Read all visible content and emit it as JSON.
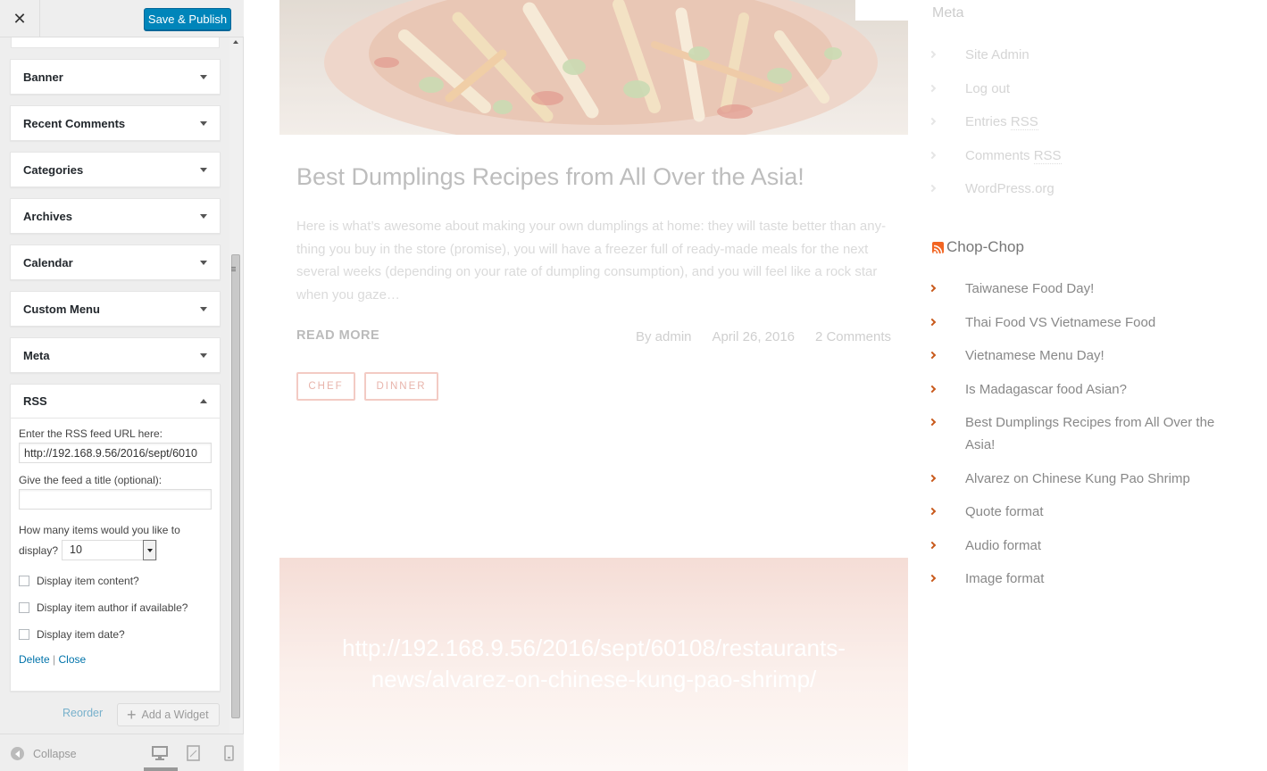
{
  "topbar": {
    "close_glyph": "✕",
    "publish_label": "Save & Publish"
  },
  "widgets": [
    {
      "title": "Banner"
    },
    {
      "title": "Recent Comments"
    },
    {
      "title": "Categories"
    },
    {
      "title": "Archives"
    },
    {
      "title": "Calendar"
    },
    {
      "title": "Custom Menu"
    },
    {
      "title": "Meta"
    }
  ],
  "rss_widget": {
    "title": "RSS",
    "url_label": "Enter the RSS feed URL here:",
    "url_value": "http://192.168.9.56/2016/sept/6010",
    "title_label": "Give the feed a title (optional):",
    "title_value": "",
    "count_label_1": "How many items would you like to",
    "count_label_2": "display?",
    "count_value": "10",
    "options": [
      {
        "label": "Display item content?",
        "checked": false
      },
      {
        "label": "Display item author if available?",
        "checked": false
      },
      {
        "label": "Display item date?",
        "checked": false
      }
    ],
    "delete_label": "Delete",
    "separator": "|",
    "close_label": "Close"
  },
  "panel_actions": {
    "reorder_label": "Reorder",
    "add_widget_label": "Add a Widget"
  },
  "footer": {
    "collapse_label": "Collapse",
    "devices": [
      "desktop-icon",
      "tablet-icon",
      "mobile-icon"
    ]
  },
  "post": {
    "title": "Best Dumplings Recipes from All Over the Asia!",
    "excerpt": "Here is what’s awesome about making your own dumplings at home: they will taste better than any-thing you buy in the store (promise), you will have a freezer full of ready-made meals for the next several weeks (depending on your rate of dumpling consumption), and you will feel like a rock star when you gaze…",
    "read_more": "READ MORE",
    "author": "By admin",
    "date": "April 26, 2016",
    "comments": "2 Comments",
    "tags": [
      "CHEF",
      "DINNER"
    ]
  },
  "quote_post": {
    "text": "http://192.168.9.56/2016/sept/60108/restaurants-news/alvarez-on-chinese-kung-pao-shrimp/"
  },
  "sidebar_meta": {
    "heading": "Meta",
    "items": [
      "Site Admin",
      "Log out",
      "Entries",
      "Comments",
      "WordPress.org"
    ],
    "rss_abbr": "RSS"
  },
  "sidebar_rss": {
    "heading": "Chop-Chop",
    "items": [
      "Taiwanese Food Day!",
      "Thai Food VS Vietnamese Food",
      "Vietnamese Menu Day!",
      "Is Madagascar food Asian?",
      "Best Dumplings Recipes from All Over the Asia!",
      "Alvarez on Chinese Kung Pao Shrimp",
      "Quote format",
      "Audio format",
      "Image format"
    ]
  },
  "colors": {
    "publish_button": "#0085ba",
    "link": "#0073aa",
    "tag_border": "#f3cbc4",
    "accent_chevron": "#c8591b",
    "rss_orange": "#f26522"
  }
}
